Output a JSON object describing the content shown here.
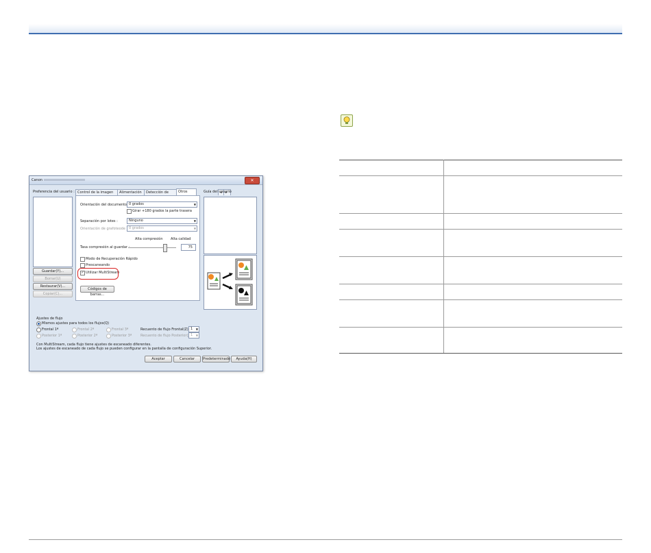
{
  "dialog": {
    "title_prefix": "Canon",
    "close_glyph": "✕",
    "user_pref_label": "Preferencia del usuario :",
    "buttons": {
      "guardar": "Guardar(Y)...",
      "borrar": "Borrar(U)",
      "restaurar": "Restaurar(V)...",
      "copiar": "Copiar(C)..."
    },
    "tabs": [
      "Control de la imagen",
      "Alimentación",
      "Detección de error",
      "Otros"
    ],
    "tab_arrows": [
      "◂",
      "▸"
    ],
    "active_tab_index": 3,
    "orientation_label": "Orientación del documento :",
    "orientation_value": "0 grados",
    "rotate_back_label": "Girar +180 grados la parte trasera",
    "separation_label": "Separación por lotes :",
    "separation_value": "Ninguno",
    "text_orientation_label": "Orientación de grafoteode :",
    "text_orientation_value": "0 grados",
    "slider_low_label": "Alta compresión",
    "slider_high_label": "Alta calidad",
    "compression_label": "Tasa compresión al guardar :",
    "compression_value": "75",
    "quick_recovery_label": "Modo de Recuperación Rápido",
    "partial_label": "Prescaneando",
    "multistream_label": "Utilizar MultiStream",
    "barcode_button": "Códigos de barras...",
    "user_guide_label": "Guía del usuario",
    "flow_settings_label": "Ajustes de flujo",
    "same_settings_label": "Mismos ajustes para todos los flujos(Q)",
    "front1": "Frontal 1ª",
    "front2": "Frontal 2ª",
    "front3": "Frontal 3ª",
    "back1": "Posterior 1ª",
    "back2": "Posterior 2ª",
    "back3": "Posterior 3ª",
    "front_count_label": "Recuento de flujo Frontal(Z)",
    "front_count_value": "1",
    "back_count_label": "Recuento de flujo Posterior(J)",
    "back_count_value": "1",
    "note_line1": "Con MultiStream, cada flujo tiene ajustes de escaneado diferentes.",
    "note_line2": "Los ajustes de escaneado de cada flujo se pueden configurar en la pantalla de configuración Superior.",
    "accept": "Aceptar",
    "cancel": "Cancelar",
    "default": "Predeterminado",
    "help": "Ayuda(H)"
  },
  "table": {
    "rows": [
      [
        "",
        ""
      ],
      [
        "",
        ""
      ],
      [
        "",
        ""
      ],
      [
        "",
        ""
      ],
      [
        "",
        ""
      ],
      [
        "",
        ""
      ],
      [
        "",
        ""
      ],
      [
        "",
        ""
      ]
    ]
  },
  "colors": {
    "accent_rule": "#3e6db0",
    "highlight": "#d92323"
  }
}
